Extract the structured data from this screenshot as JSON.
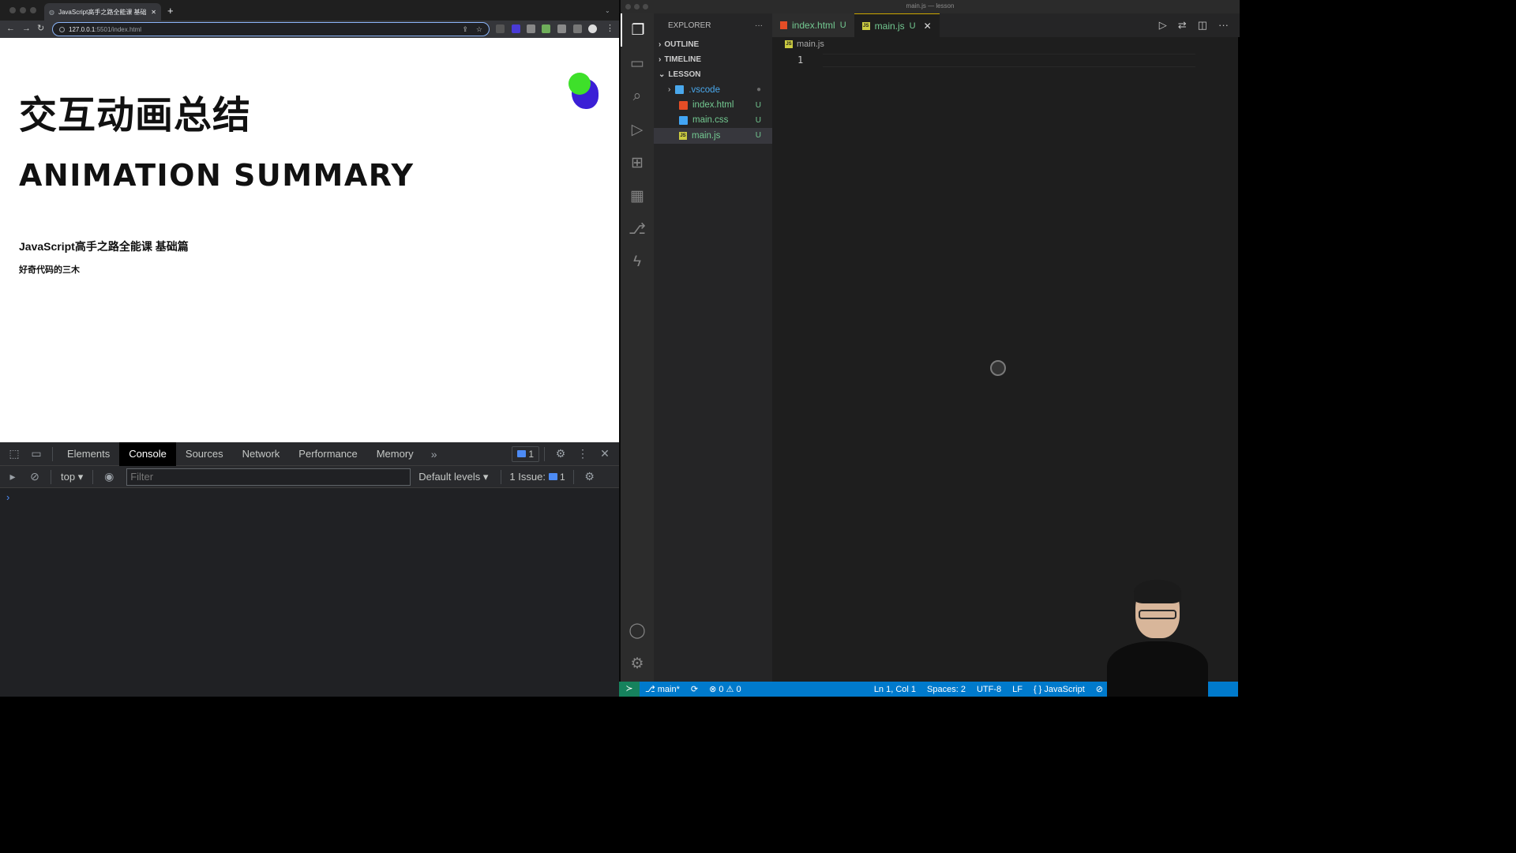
{
  "browser": {
    "tab_title": "JavaScript高手之路全能课 基础",
    "url_host": "127.0.0.1",
    "url_path": ":5501/index.html"
  },
  "page": {
    "title_cn": "交互动画总结",
    "title_en": "ANIMATION SUMMARY",
    "subtitle": "JavaScript高手之路全能课 基础篇",
    "author": "好奇代码的三木"
  },
  "devtools": {
    "tabs": [
      "Elements",
      "Console",
      "Sources",
      "Network",
      "Performance",
      "Memory"
    ],
    "active_tab": "Console",
    "message_count": "1",
    "context": "top",
    "filter_placeholder": "Filter",
    "levels": "Default levels",
    "issues_label": "1 Issue:",
    "issues_count": "1",
    "prompt": "›"
  },
  "vscode": {
    "window_title": "main.js — lesson",
    "explorer_label": "EXPLORER",
    "sections": {
      "outline": "OUTLINE",
      "timeline": "TIMELINE",
      "lesson": "LESSON"
    },
    "files": [
      {
        "name": ".vscode",
        "status": "",
        "color": "#4aa8ec",
        "type": "folder"
      },
      {
        "name": "index.html",
        "status": "U",
        "color": "#73c991",
        "type": "html"
      },
      {
        "name": "main.css",
        "status": "U",
        "color": "#73c991",
        "type": "css"
      },
      {
        "name": "main.js",
        "status": "U",
        "color": "#73c991",
        "type": "js"
      }
    ],
    "editor_tabs": [
      {
        "name": "index.html",
        "status": "U"
      },
      {
        "name": "main.js",
        "status": "U"
      }
    ],
    "breadcrumb": "main.js",
    "line_number": "1",
    "status": {
      "branch": "main*",
      "errors": "0",
      "warnings": "0",
      "position": "Ln 1, Col 1",
      "spaces": "Spaces: 2",
      "encoding": "UTF-8",
      "eol": "LF",
      "language": "JavaScript"
    }
  },
  "colors": {
    "accent": "#007acc",
    "untracked": "#73c991",
    "blob_green": "#3ee02a",
    "blob_blue": "#3b1fd6"
  }
}
